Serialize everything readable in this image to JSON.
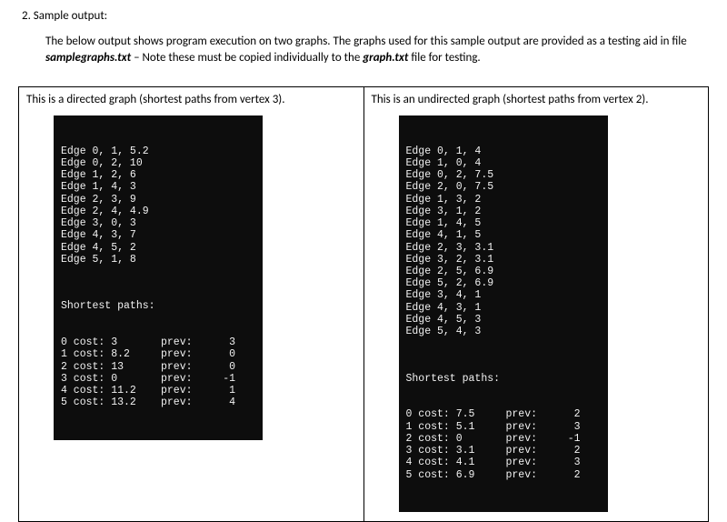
{
  "heading": "2.  Sample output:",
  "intro_part1": "The below output shows program execution on two graphs.  The graphs used for this sample output are provided as a testing aid in file ",
  "intro_file1": "samplegraphs.txt",
  "intro_part2": " – Note these must be copied individually to the ",
  "intro_file2": "graph.txt",
  "intro_part3": " file for testing.",
  "left": {
    "caption": "This is a directed graph (shortest paths from vertex 3).",
    "edges": [
      "Edge 0, 1, 5.2",
      "Edge 0, 2, 10",
      "Edge 1, 2, 6",
      "Edge 1, 4, 3",
      "Edge 2, 3, 9",
      "Edge 2, 4, 4.9",
      "Edge 3, 0, 3",
      "Edge 4, 3, 7",
      "Edge 4, 5, 2",
      "Edge 5, 1, 8"
    ],
    "sp_title": "Shortest paths:",
    "sp": [
      {
        "c1": "0 cost: 3",
        "c2": "prev:",
        "c3": "3"
      },
      {
        "c1": "1 cost: 8.2",
        "c2": "prev:",
        "c3": "0"
      },
      {
        "c1": "2 cost: 13",
        "c2": "prev:",
        "c3": "0"
      },
      {
        "c1": "3 cost: 0",
        "c2": "prev:",
        "c3": "-1"
      },
      {
        "c1": "4 cost: 11.2",
        "c2": "prev:",
        "c3": "1"
      },
      {
        "c1": "5 cost: 13.2",
        "c2": "prev:",
        "c3": "4"
      }
    ]
  },
  "right": {
    "caption": "This is an undirected graph (shortest paths from vertex 2).",
    "edges": [
      "Edge 0, 1, 4",
      "Edge 1, 0, 4",
      "Edge 0, 2, 7.5",
      "Edge 2, 0, 7.5",
      "Edge 1, 3, 2",
      "Edge 3, 1, 2",
      "Edge 1, 4, 5",
      "Edge 4, 1, 5",
      "Edge 2, 3, 3.1",
      "Edge 3, 2, 3.1",
      "Edge 2, 5, 6.9",
      "Edge 5, 2, 6.9",
      "Edge 3, 4, 1",
      "Edge 4, 3, 1",
      "Edge 4, 5, 3",
      "Edge 5, 4, 3"
    ],
    "sp_title": "Shortest paths:",
    "sp": [
      {
        "c1": "0 cost: 7.5",
        "c2": "prev:",
        "c3": "2"
      },
      {
        "c1": "1 cost: 5.1",
        "c2": "prev:",
        "c3": "3"
      },
      {
        "c1": "2 cost: 0",
        "c2": "prev:",
        "c3": "-1"
      },
      {
        "c1": "3 cost: 3.1",
        "c2": "prev:",
        "c3": "2"
      },
      {
        "c1": "4 cost: 4.1",
        "c2": "prev:",
        "c3": "3"
      },
      {
        "c1": "5 cost: 6.9",
        "c2": "prev:",
        "c3": "2"
      }
    ]
  }
}
